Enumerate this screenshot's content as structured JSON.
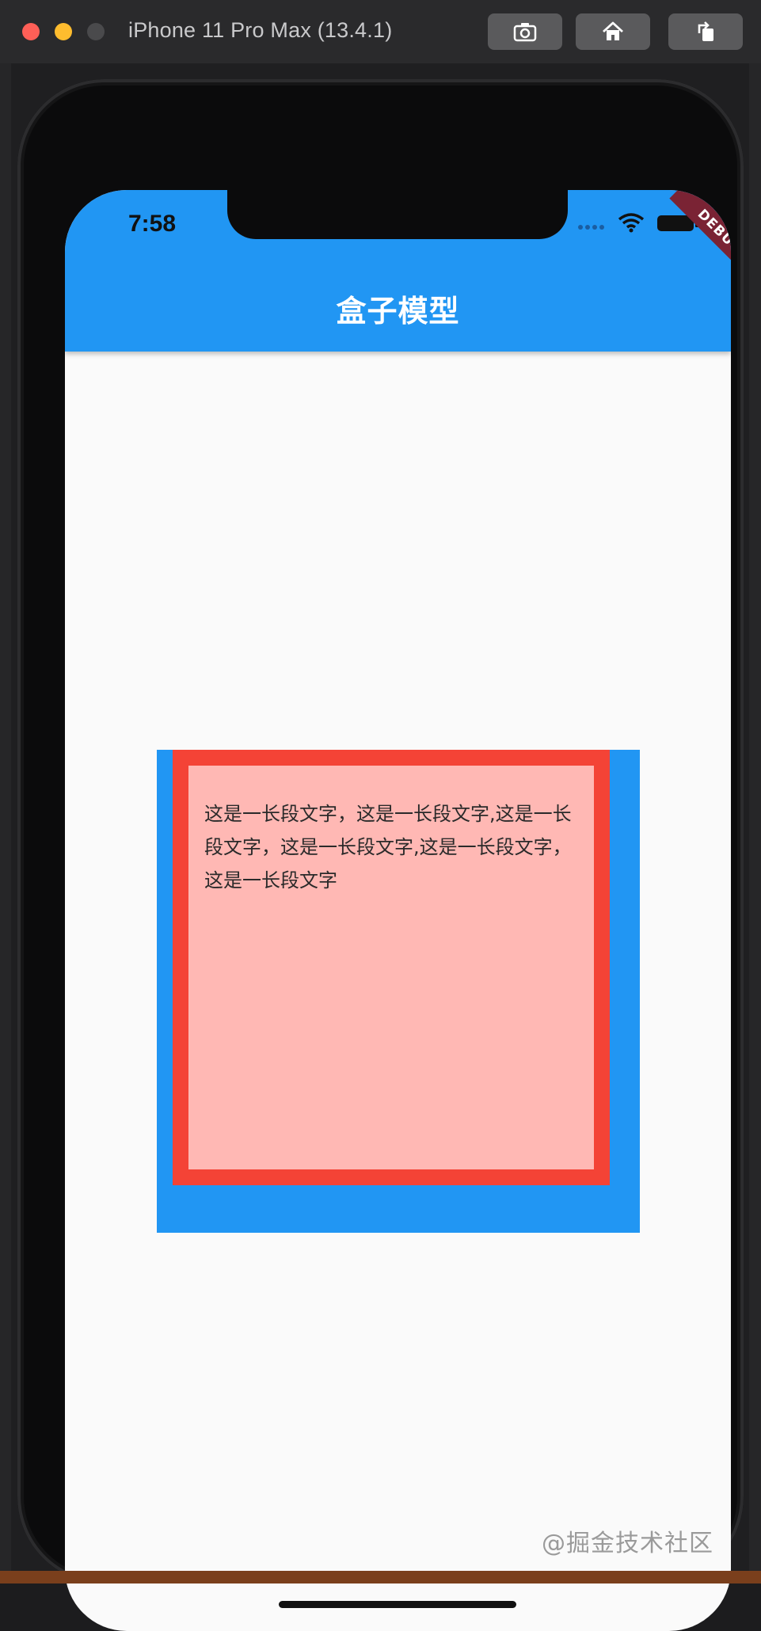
{
  "window": {
    "title": "iPhone 11 Pro Max (13.4.1)",
    "buttons": [
      "screenshot-icon",
      "home-icon",
      "rotate-icon"
    ]
  },
  "status_bar": {
    "time": "7:58"
  },
  "app_bar": {
    "title": "盒子模型"
  },
  "debug_banner": "DEBUG",
  "content": {
    "paragraph": "这是一长段文字，这是一长段文字,这是一长段文字，这是一长段文字,这是一长段文字，这是一长段文字"
  },
  "colors": {
    "app_bar": "#2196f3",
    "outer_box": "#2196f3",
    "border": "#f44336",
    "inner_box": "#ffb8b4",
    "screen_background": "#fafafa"
  },
  "watermark": "@掘金技术社区"
}
